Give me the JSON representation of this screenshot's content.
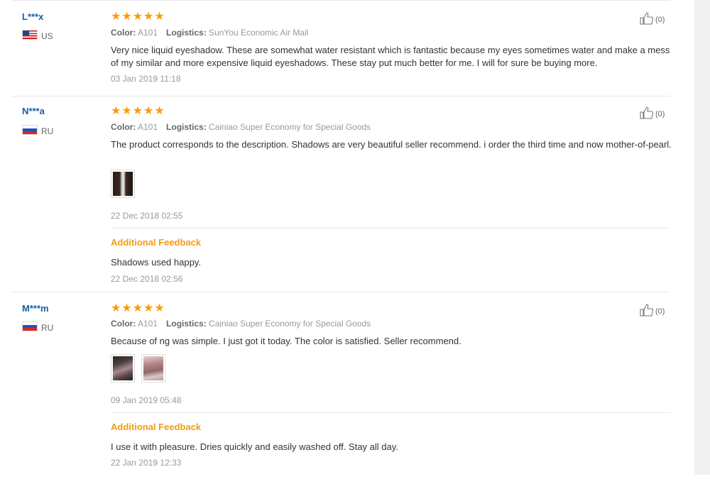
{
  "reviews": [
    {
      "username": "L***x",
      "country": "US",
      "stars": "★★★★★",
      "color_label": "Color:",
      "color_value": "A101",
      "logistics_label": "Logistics:",
      "logistics_value": "SunYou Economic Air Mail",
      "text": "Very nice liquid eyeshadow. These are somewhat water resistant which is fantastic because my eyes sometimes water and make a mess of my similar and more expensive liquid eyeshadows. These stay put much better for me. I will for sure be buying more.",
      "date": "03 Jan 2019 11:18",
      "helpful": "(0)"
    },
    {
      "username": "N***a",
      "country": "RU",
      "stars": "★★★★★",
      "color_label": "Color:",
      "color_value": "A101",
      "logistics_label": "Logistics:",
      "logistics_value": "Cainiao Super Economy for Special Goods",
      "text": "The product corresponds to the description. Shadows are very beautiful seller recommend. i order the third time and now mother-of-pearl.",
      "date": "22 Dec 2018 02:55",
      "helpful": "(0)",
      "additional": {
        "title": "Additional Feedback",
        "text": "Shadows used happy.",
        "date": "22 Dec 2018 02:56"
      }
    },
    {
      "username": "M***m",
      "country": "RU",
      "stars": "★★★★★",
      "color_label": "Color:",
      "color_value": "A101",
      "logistics_label": "Logistics:",
      "logistics_value": "Cainiao Super Economy for Special Goods",
      "text": "Because of ng was simple. I just got it today. The color is satisfied. Seller recommend.",
      "date": "09 Jan 2019 05:48",
      "helpful": "(0)",
      "additional": {
        "title": "Additional Feedback",
        "text": "I use it with pleasure. Dries quickly and easily washed off. Stay all day.",
        "date": "22 Jan 2019 12:33"
      }
    }
  ],
  "icons": {
    "helpful": "thumbs-up-icon",
    "rating": "star-icon"
  },
  "colors": {
    "username": "#1a5ea8",
    "stars": "#ff9a00",
    "additional_title": "#f39c12"
  }
}
